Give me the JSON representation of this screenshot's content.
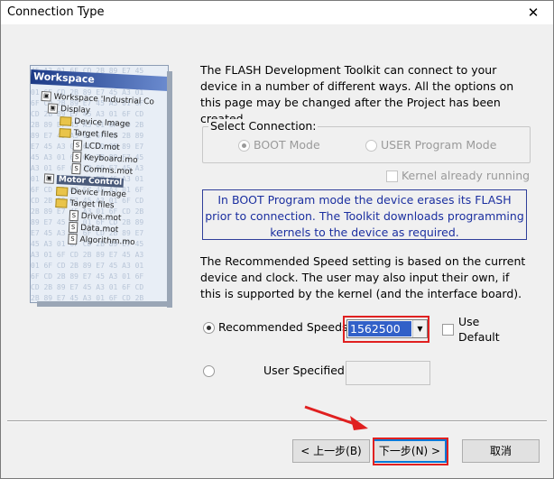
{
  "window": {
    "title": "Connection Type",
    "close_glyph": "✕"
  },
  "illustration": {
    "workspace_bar": "Workspace",
    "tree": [
      {
        "label": "Workspace 'Industrial Co",
        "kind": "ws"
      },
      {
        "label": "Display",
        "kind": "proj"
      },
      {
        "label": "Device Image",
        "kind": "folder"
      },
      {
        "label": "Target files",
        "kind": "folder"
      },
      {
        "label": "LCD.mot",
        "kind": "file"
      },
      {
        "label": "Keyboard.mo",
        "kind": "file"
      },
      {
        "label": "Comms.mot",
        "kind": "file"
      },
      {
        "label": "Motor Control",
        "kind": "proj-hl"
      },
      {
        "label": "Device Image",
        "kind": "folder"
      },
      {
        "label": "Target files",
        "kind": "folder"
      },
      {
        "label": "Drive.mot",
        "kind": "file"
      },
      {
        "label": "Data.mot",
        "kind": "file"
      },
      {
        "label": "Algorithm.mo",
        "kind": "file"
      }
    ]
  },
  "intro_text": "The FLASH Development Toolkit can connect to your device in a number of different ways. All the options on this page may be changed after the Project has been created.",
  "select_connection": {
    "legend": "Select Connection:",
    "boot_label": "BOOT Mode",
    "user_program_label": "USER Program Mode",
    "selected": "BOOT Mode"
  },
  "kernel_running_label": "Kernel already running",
  "info_text": "In BOOT Program mode the device erases its FLASH prior to connection. The Toolkit downloads programming kernels to the device as required.",
  "speed_text": "The Recommended Speed setting is based on the current device and clock. The user may also input their own, if this is supported by the kernel (and the interface board).",
  "speed": {
    "recommended_label": "Recommended Speeds:",
    "recommended_value": "1562500",
    "use_default_label": "Use Default",
    "user_specified_label": "User Specified:",
    "user_specified_value": ""
  },
  "buttons": {
    "back": "< 上一步(B)",
    "next": "下一步(N) >",
    "cancel": "取消"
  },
  "colors": {
    "info_text": "#1b2fa0",
    "selection": "#3260c8",
    "annotation": "#e02020"
  }
}
